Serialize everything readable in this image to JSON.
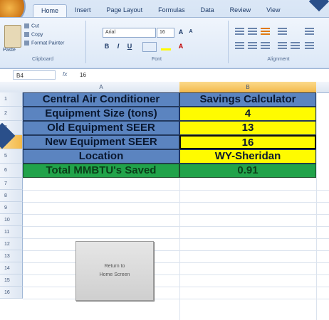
{
  "ribbon": {
    "tabs": [
      "Home",
      "Insert",
      "Page Layout",
      "Formulas",
      "Data",
      "Review",
      "View"
    ],
    "active_tab": "Home",
    "clipboard": {
      "paste_label": "Paste",
      "cut_label": "Cut",
      "copy_label": "Copy",
      "format_painter_label": "Format Painter",
      "group_label": "Clipboard"
    },
    "font": {
      "family": "Arial",
      "size": "16",
      "group_label": "Font",
      "bold": "B",
      "italic": "I",
      "underline": "U"
    },
    "alignment": {
      "group_label": "Alignment"
    }
  },
  "formula_bar": {
    "name_box": "B4",
    "fx": "fx",
    "value": "16"
  },
  "columns": [
    "A",
    "B"
  ],
  "selected_column": "B",
  "rows": [
    "1",
    "2",
    "3",
    "4",
    "5",
    "6",
    "7",
    "8",
    "9",
    "10",
    "11",
    "12",
    "13",
    "14",
    "15",
    "16"
  ],
  "selected_row": "4",
  "calculator": {
    "title_left": "Central Air Conditioner",
    "title_right": "Savings Calculator",
    "inputs": [
      {
        "label": "Equipment Size (tons)",
        "value": "4"
      },
      {
        "label": "Old Equipment SEER",
        "value": "13"
      },
      {
        "label": "New Equipment SEER",
        "value": "16"
      },
      {
        "label": "Location",
        "value": "WY-Sheridan"
      }
    ],
    "result": {
      "label": "Total MMBTU's Saved",
      "value": "0.91"
    }
  },
  "return_button": {
    "line1": "Return to",
    "line2": "Home Screen"
  },
  "colors": {
    "header_blue": "#5b84c0",
    "input_yellow": "#fffb00",
    "result_green": "#21a34a"
  }
}
